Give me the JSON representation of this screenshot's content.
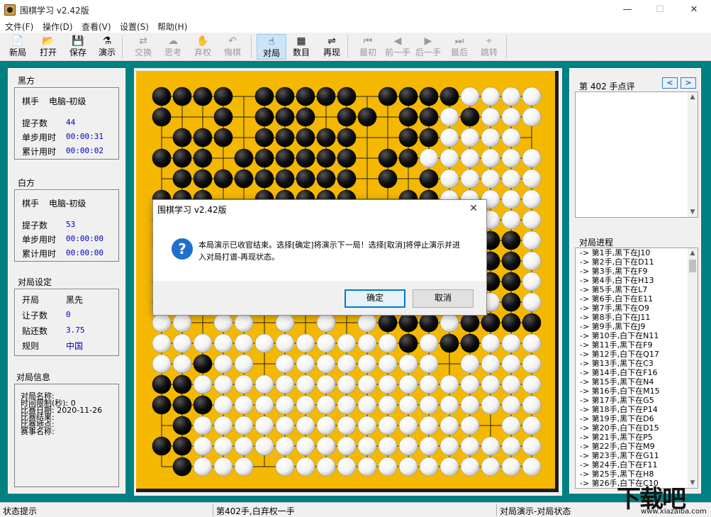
{
  "window": {
    "title": "围棋学习 v2.42版",
    "minimize": "—",
    "maximize": "☐",
    "close": "✕"
  },
  "menu": [
    "文件(F)",
    "操作(D)",
    "查看(V)",
    "设置(S)",
    "帮助(H)"
  ],
  "toolbar": [
    {
      "label": "新局",
      "icon": "new-game-icon",
      "glyph": "📄",
      "enabled": true
    },
    {
      "label": "打开",
      "icon": "open-folder-icon",
      "glyph": "📂",
      "enabled": true
    },
    {
      "label": "保存",
      "icon": "save-disk-icon",
      "glyph": "💾",
      "enabled": true
    },
    {
      "label": "演示",
      "icon": "demo-icon",
      "glyph": "⚗",
      "enabled": true
    },
    {
      "label": "交换",
      "icon": "swap-icon",
      "glyph": "⇄",
      "enabled": false
    },
    {
      "label": "思考",
      "icon": "think-icon",
      "glyph": "☁",
      "enabled": false
    },
    {
      "label": "弃权",
      "icon": "pass-icon",
      "glyph": "✋",
      "enabled": false
    },
    {
      "label": "悔棋",
      "icon": "undo-icon",
      "glyph": "↶",
      "enabled": false
    },
    {
      "label": "对局",
      "icon": "play-hand-icon",
      "glyph": "☝",
      "enabled": true,
      "active": true
    },
    {
      "label": "数目",
      "icon": "count-grid-icon",
      "glyph": "▦",
      "enabled": true
    },
    {
      "label": "再现",
      "icon": "replay-icon",
      "glyph": "⇌",
      "enabled": true
    },
    {
      "label": "最初",
      "icon": "first-move-icon",
      "glyph": "⏮",
      "enabled": false
    },
    {
      "label": "前一手",
      "icon": "prev-move-icon",
      "glyph": "◀",
      "enabled": false
    },
    {
      "label": "后一手",
      "icon": "next-move-icon",
      "glyph": "▶",
      "enabled": false
    },
    {
      "label": "最后",
      "icon": "last-move-icon",
      "glyph": "⏭",
      "enabled": false
    },
    {
      "label": "跳转",
      "icon": "jump-binoculars-icon",
      "glyph": "⌖",
      "enabled": false
    }
  ],
  "black_side": {
    "title": "黑方",
    "player_label": "棋手",
    "player_value": "电脑-初级",
    "captures_label": "提子数",
    "captures_value": "44",
    "step_time_label": "单步用时",
    "step_time_value": "00:00:31",
    "total_time_label": "累计用时",
    "total_time_value": "00:00:02"
  },
  "white_side": {
    "title": "白方",
    "player_label": "棋手",
    "player_value": "电脑-初级",
    "captures_label": "提子数",
    "captures_value": "53",
    "step_time_label": "单步用时",
    "step_time_value": "00:00:00",
    "total_time_label": "累计用时",
    "total_time_value": "00:00:00"
  },
  "settings": {
    "title": "对局设定",
    "opening_label": "开局",
    "opening_value": "黑先",
    "handicap_label": "让子数",
    "handicap_value": "0",
    "komi_label": "贴还数",
    "komi_value": "3.75",
    "rules_label": "规则",
    "rules_value": "中国"
  },
  "game_info": {
    "title": "对局信息",
    "lines": [
      "对局名称:",
      "时间限制(秒): 0",
      "比赛日期: 2020-11-26",
      "比赛结果:",
      "比赛地点:",
      "赛事名称:"
    ]
  },
  "comment": {
    "title": "第 402 手点评",
    "prev": "<",
    "next": ">"
  },
  "progress": {
    "title": "对局进程",
    "moves": [
      "-> 第1手,黑下在J10",
      "-> 第2手,白下在D11",
      "-> 第3手,黑下在F9",
      "-> 第4手,白下在H13",
      "-> 第5手,黑下在L7",
      "-> 第6手,白下在E11",
      "-> 第7手,黑下在O9",
      "-> 第8手,白下在J11",
      "-> 第9手,黑下在J9",
      "-> 第10手,白下在N11",
      "-> 第11手,黑下在F9",
      "-> 第12手,白下在Q17",
      "-> 第13手,黑下在C3",
      "-> 第14手,白下在F16",
      "-> 第15手,黑下在N4",
      "-> 第16手,白下在M15",
      "-> 第17手,黑下在G5",
      "-> 第18手,白下在P14",
      "-> 第19手,黑下在D6",
      "-> 第20手,白下在D15",
      "-> 第21手,黑下在P5",
      "-> 第22手,白下在M9",
      "-> 第23手,黑下在G11",
      "-> 第24手,白下在F11",
      "-> 第25手,黑下在H8",
      "-> 第26手,白下在C10"
    ]
  },
  "status": {
    "hint": "状态提示",
    "move": "第402手,白弃权一手",
    "mode": "对局演示-对局状态"
  },
  "dialog": {
    "title": "围棋学习 v2.42版",
    "icon": "question-icon",
    "message": "本局演示已收官结束。选择[确定]将演示下一局！选择[取消]将停止演示并进入对局打谱-再现状态。",
    "ok": "确定",
    "cancel": "取消"
  },
  "watermark": {
    "big": "下载吧",
    "small": "www.xiazaiba.com"
  },
  "colors": {
    "board": "#f4b800",
    "background": "#008080",
    "value_blue": "#0000c8",
    "accent": "#0078d7"
  },
  "board": {
    "size": 19,
    "rows": [
      "BBBB.BBBBB.BBBBWWWW",
      "B..B.BBB.BB.BBWBWWW",
      ".BBB.BBBBB..BBWWWW.",
      "BBB.BBBBBB.BBWWWWWW",
      ".BBBBBBBBB.B.BWWWWW",
      "BBB..BBBBB..BBWWWWW",
      "BB.BBBBBB..BBBWWWWW",
      "BBB.BBBBBB.BBWWWBBW",
      ".BB..BBBBB..BBBWBBW",
      "BB...BBBB.B.BBBBBBW",
      "BB.BBBBBBB.BBBBBWBW",
      "WW.WW.W.W.WBBBWBBBB",
      "WWWWWWWWWWWWBWBBWWW",
      "WWBWW.WWWWWWWW.WWWW",
      "BBWWWWWWWWWWWWWWWWW",
      "BBBWWWWWWWWWWWWWWWW",
      ".BWWWWWWWWWWWWWW.WW",
      "BBWWWWWWWWWWWWWWWWW",
      ".BWWW.WWWWWWWWWWWWW"
    ]
  }
}
